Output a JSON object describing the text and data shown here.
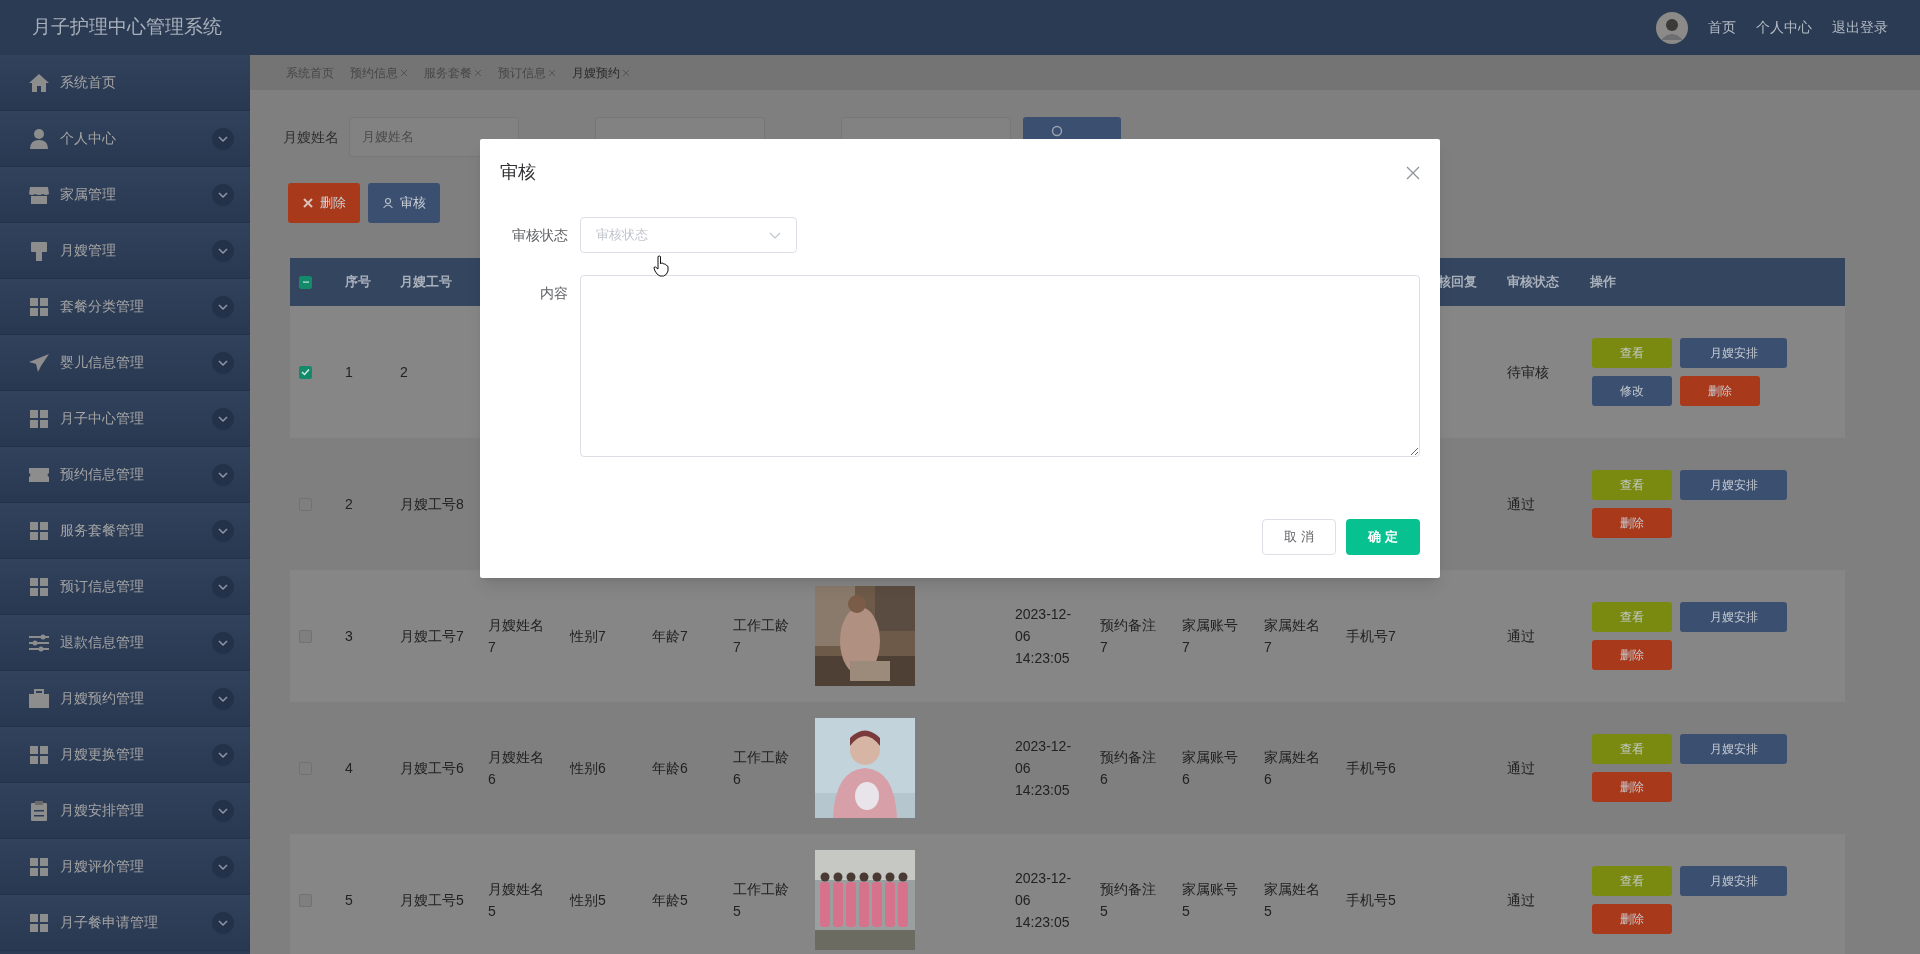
{
  "app_title": "月子护理中心管理系统",
  "top_nav": [
    "首页",
    "个人中心",
    "退出登录"
  ],
  "sidebar": {
    "items": [
      {
        "label": "系统首页",
        "expandable": false
      },
      {
        "label": "个人中心",
        "expandable": true
      },
      {
        "label": "家属管理",
        "expandable": true
      },
      {
        "label": "月嫂管理",
        "expandable": true
      },
      {
        "label": "套餐分类管理",
        "expandable": true
      },
      {
        "label": "婴儿信息管理",
        "expandable": true
      },
      {
        "label": "月子中心管理",
        "expandable": true
      },
      {
        "label": "预约信息管理",
        "expandable": true
      },
      {
        "label": "服务套餐管理",
        "expandable": true
      },
      {
        "label": "预订信息管理",
        "expandable": true
      },
      {
        "label": "退款信息管理",
        "expandable": true
      },
      {
        "label": "月嫂预约管理",
        "expandable": true
      },
      {
        "label": "月嫂更换管理",
        "expandable": true
      },
      {
        "label": "月嫂安排管理",
        "expandable": true
      },
      {
        "label": "月嫂评价管理",
        "expandable": true
      },
      {
        "label": "月子餐申请管理",
        "expandable": true
      }
    ]
  },
  "tabs": [
    {
      "label": "系统首页",
      "closable": false,
      "selected": false
    },
    {
      "label": "预约信息",
      "closable": true,
      "selected": false
    },
    {
      "label": "服务套餐",
      "closable": true,
      "selected": false
    },
    {
      "label": "预订信息",
      "closable": true,
      "selected": false
    },
    {
      "label": "月嫂预约",
      "closable": true,
      "selected": true
    }
  ],
  "filters": [
    {
      "label": "月嫂姓名",
      "placeholder": "月嫂姓名"
    }
  ],
  "toolbar": [
    {
      "kind": "delete",
      "label": "删除"
    },
    {
      "kind": "review",
      "label": "审核"
    }
  ],
  "table": {
    "select_all": {
      "indeterminate": true
    },
    "columns": [
      "序号",
      "月嫂工号",
      "核回复",
      "审核状态",
      "操作"
    ],
    "rows": [
      {
        "checked": true,
        "no": "1",
        "worker_id": "2",
        "status": "待审核",
        "actions": [
          {
            "kind": "view",
            "label": "查看"
          },
          {
            "kind": "arrange",
            "label": "月嫂安排"
          },
          {
            "kind": "edit",
            "label": "修改"
          },
          {
            "kind": "delete",
            "label": "删除"
          }
        ]
      },
      {
        "checked": false,
        "no": "2",
        "worker_id": "月嫂工号8",
        "status": "通过",
        "actions": [
          {
            "kind": "view",
            "label": "查看"
          },
          {
            "kind": "arrange",
            "label": "月嫂安排"
          },
          {
            "kind": "delete",
            "label": "删除"
          }
        ]
      },
      {
        "checked": false,
        "no": "3",
        "worker_id": "月嫂工号7",
        "name": "月嫂姓名7",
        "gender": "性别7",
        "age": "年龄7",
        "years": "工作工龄7",
        "photo": {
          "kind": "picture"
        },
        "date": "2023-12-06 14:23:05",
        "note": "预约备注7",
        "account": "家属账号7",
        "family_name": "家属姓名7",
        "phone": "手机号7",
        "status": "通过",
        "actions": [
          {
            "kind": "view",
            "label": "查看"
          },
          {
            "kind": "arrange",
            "label": "月嫂安排"
          },
          {
            "kind": "delete",
            "label": "删除"
          }
        ]
      },
      {
        "checked": false,
        "no": "4",
        "worker_id": "月嫂工号6",
        "name": "月嫂姓名6",
        "gender": "性别6",
        "age": "年龄6",
        "years": "工作工龄6",
        "photo": {
          "kind": "picture"
        },
        "date": "2023-12-06 14:23:05",
        "note": "预约备注6",
        "account": "家属账号6",
        "family_name": "家属姓名6",
        "phone": "手机号6",
        "status": "通过",
        "actions": [
          {
            "kind": "view",
            "label": "查看"
          },
          {
            "kind": "arrange",
            "label": "月嫂安排"
          },
          {
            "kind": "delete",
            "label": "删除"
          }
        ]
      },
      {
        "checked": false,
        "no": "5",
        "worker_id": "月嫂工号5",
        "name": "月嫂姓名5",
        "gender": "性别5",
        "age": "年龄5",
        "years": "工作工龄5",
        "photo": {
          "kind": "picture"
        },
        "date": "2023-12-06 14:23:05",
        "note": "预约备注5",
        "account": "家属账号5",
        "family_name": "家属姓名5",
        "phone": "手机号5",
        "status": "通过",
        "actions": [
          {
            "kind": "view",
            "label": "查看"
          },
          {
            "kind": "arrange",
            "label": "月嫂安排"
          },
          {
            "kind": "delete",
            "label": "删除"
          }
        ]
      }
    ]
  },
  "dialog": {
    "title": "审核",
    "fields": [
      {
        "kind": "select",
        "label": "审核状态",
        "placeholder": "审核状态"
      },
      {
        "kind": "textarea",
        "label": "内容"
      }
    ],
    "buttons": [
      {
        "kind": "cancel",
        "label": "取 消"
      },
      {
        "kind": "confirm",
        "label": "确 定"
      }
    ]
  }
}
